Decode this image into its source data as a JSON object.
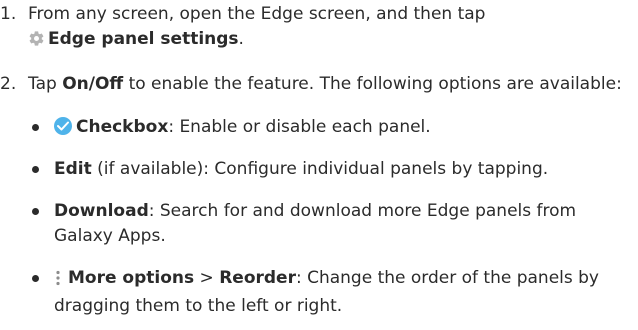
{
  "steps": [
    {
      "number": "1.",
      "text_a": "From any screen, open the Edge screen, and then tap",
      "bold": "Edge panel settings",
      "text_b": ".",
      "icon": "gear-icon"
    },
    {
      "number": "2.",
      "text_a": "Tap ",
      "bold": "On/Off",
      "text_b": " to enable the feature. The following options are available:"
    }
  ],
  "bullets": [
    {
      "icon": "checkbox-icon",
      "bold": "Checkbox",
      "text": ": Enable or disable each panel."
    },
    {
      "bold": "Edit",
      "text": " (if available): Configure individual panels by tapping."
    },
    {
      "bold": "Download",
      "text": ": Search for and download more Edge panels from Galaxy Apps."
    },
    {
      "icon": "more-options-icon",
      "bold": "More options",
      "sep": " > ",
      "bold2": "Reorder",
      "text": ": Change the order of the panels by dragging them to the left or right."
    }
  ],
  "colors": {
    "text": "#2b2b2b",
    "gear_icon": "#b3b3b3",
    "checkbox_icon": "#4fb3ea"
  }
}
